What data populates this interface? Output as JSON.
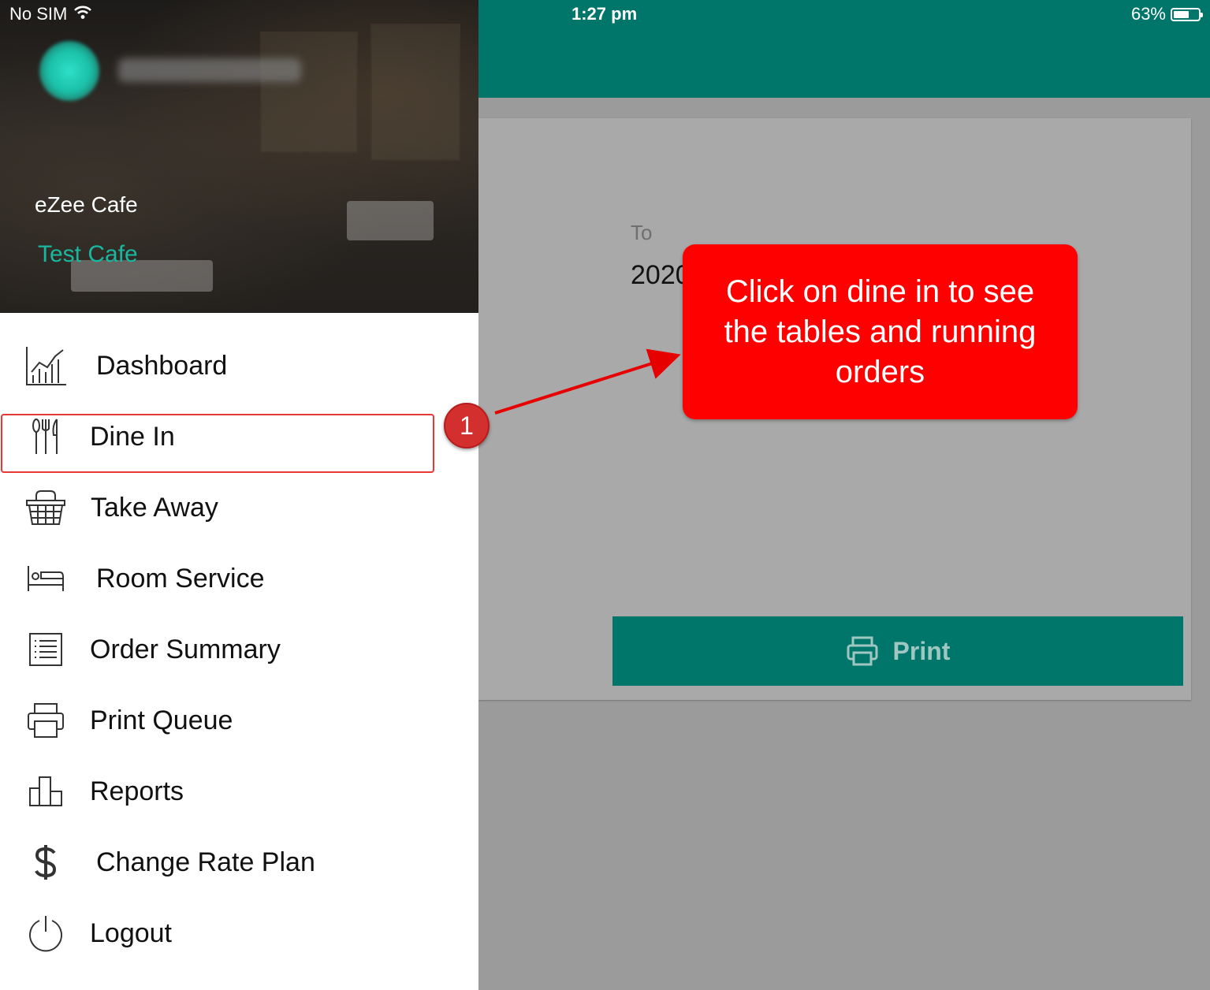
{
  "status_bar": {
    "carrier": "No SIM",
    "time": "1:27 pm",
    "battery": "63%",
    "battery_level": 0.63
  },
  "drawer": {
    "cafe_name": "eZee Cafe",
    "outlet_name": "Test Cafe",
    "items": [
      {
        "label": "Dashboard",
        "icon": "chart-icon"
      },
      {
        "label": "Dine In",
        "icon": "cutlery-icon"
      },
      {
        "label": "Take Away",
        "icon": "basket-icon"
      },
      {
        "label": "Room Service",
        "icon": "bed-icon"
      },
      {
        "label": "Order Summary",
        "icon": "list-icon"
      },
      {
        "label": "Print Queue",
        "icon": "printer-icon"
      },
      {
        "label": "Reports",
        "icon": "bar-chart-icon"
      },
      {
        "label": "Change Rate Plan",
        "icon": "dollar-icon"
      },
      {
        "label": "Logout",
        "icon": "power-icon"
      }
    ]
  },
  "main": {
    "to_label": "To",
    "to_value": "2020",
    "print_label": "Print"
  },
  "annotation": {
    "step_number": "1",
    "callout_text": "Click on dine in to see the tables and running orders"
  }
}
